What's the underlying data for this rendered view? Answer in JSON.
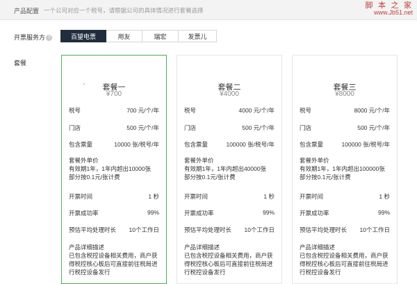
{
  "header": {
    "title": "产品配置",
    "description": "一个公司对应一个税号，请根据公司的具体情况进行套餐选择"
  },
  "watermark": {
    "main": "脚 本 之 家",
    "url": "www.Jb51.net"
  },
  "service": {
    "label": "开票服务方",
    "help_icon": "?",
    "tabs": [
      "百望电票",
      "用友",
      "瑞宏",
      "发票儿"
    ],
    "active_tab": "百望电票"
  },
  "package_label": "套餐",
  "labels": {
    "tax": "税号",
    "store": "门店",
    "quota": "包含票量",
    "extra_title": "套餐外单价",
    "time": "开票时间",
    "rate": "开票成功率",
    "process": "预估平均处理时长",
    "detail_title": "产品详细描述"
  },
  "plans": [
    {
      "name": "套餐一",
      "price": "¥700",
      "tax": "700 元/个/年",
      "store": "500 元/个/年",
      "quota": "10000 张/税号/年",
      "extra_line1": "有效期1年，1年内超出10000张",
      "extra_line2": "部分按0.1元/张计费",
      "time": "1 秒",
      "rate": "99%",
      "process": "10个工作日",
      "detail_line1": "已包含税控设备相关费用，商户获",
      "detail_line2": "得税控核心板后可直接前往税局进",
      "detail_line3": "行税控设备发行"
    },
    {
      "name": "套餐二",
      "price": "¥4000",
      "tax": "4000 元/个/年",
      "store": "500 元/个/年",
      "quota": "100000 张/税号/年",
      "extra_line1": "有效期1年，1年内超出40000张",
      "extra_line2": "部分按0.1元/张计费",
      "time": "1 秒",
      "rate": "99%",
      "process": "10个工作日",
      "detail_line1": "已包含税控设备相关费用，商户获",
      "detail_line2": "得税控核心板后可直接前往税局进",
      "detail_line3": "行税控设备发行"
    },
    {
      "name": "套餐三",
      "price": "¥8000",
      "tax": "8000 元/个/年",
      "store": "500 元/个/年",
      "quota": "100000 张/税号/年",
      "extra_line1": "有效期1年，1年内超出100000张",
      "extra_line2": "部分按0.1元/张计费",
      "time": "1 秒",
      "rate": "99%",
      "process": "10个工作日",
      "detail_line1": "已包含税控设备相关费用，商户获",
      "detail_line2": "得税控核心板后可直接前往税局进",
      "detail_line3": "行税控设备发行"
    }
  ],
  "selected_plan": "套餐一",
  "colors": {
    "active_tab_bg": "#1f2d3d",
    "selected_border": "#4caf50",
    "watermark": "#c23b3b"
  }
}
